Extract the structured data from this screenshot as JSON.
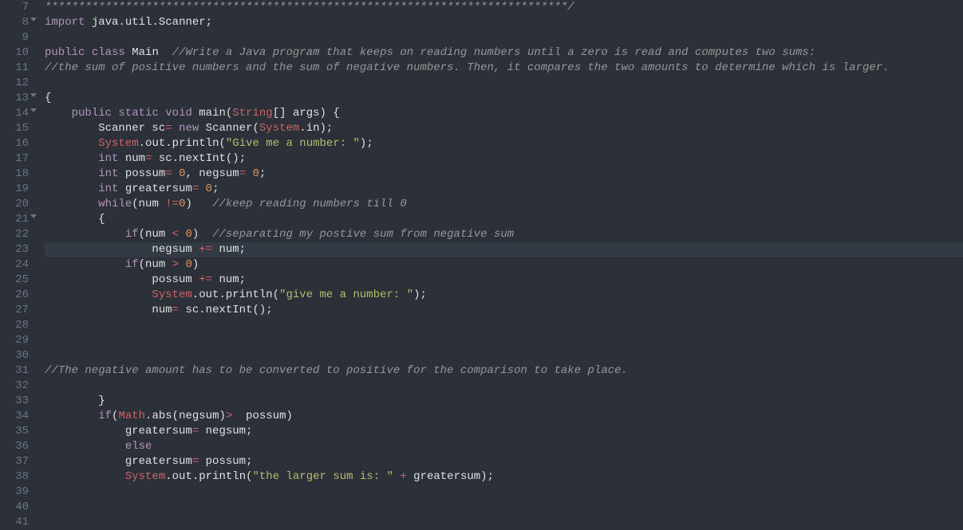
{
  "editor": {
    "startLine": 7,
    "activeLine": 23,
    "foldLines": [
      8,
      13,
      14,
      21
    ],
    "lines": [
      {
        "n": 7,
        "segs": [
          {
            "cls": "tok-comment",
            "t": "******************************************************************************/"
          }
        ]
      },
      {
        "n": 8,
        "segs": [
          {
            "cls": "tok-keyword2",
            "t": "import"
          },
          {
            "cls": "tok-ident",
            "t": " java"
          },
          {
            "cls": "tok-dot",
            "t": "."
          },
          {
            "cls": "tok-ident",
            "t": "util"
          },
          {
            "cls": "tok-dot",
            "t": "."
          },
          {
            "cls": "tok-ident",
            "t": "Scanner"
          },
          {
            "cls": "tok-punct",
            "t": ";"
          }
        ]
      },
      {
        "n": 9,
        "segs": []
      },
      {
        "n": 10,
        "segs": [
          {
            "cls": "tok-keyword2",
            "t": "public"
          },
          {
            "cls": "",
            "t": " "
          },
          {
            "cls": "tok-keyword2",
            "t": "class"
          },
          {
            "cls": "",
            "t": " "
          },
          {
            "cls": "tok-classname",
            "t": "Main"
          },
          {
            "cls": "",
            "t": "  "
          },
          {
            "cls": "tok-comment",
            "t": "//Write a Java program that keeps on reading numbers until a zero is read and computes two sums:"
          }
        ]
      },
      {
        "n": 11,
        "segs": [
          {
            "cls": "tok-comment",
            "t": "//the sum of positive numbers and the sum of negative numbers. Then, it compares the two amounts to determine which is larger."
          }
        ]
      },
      {
        "n": 12,
        "segs": []
      },
      {
        "n": 13,
        "segs": [
          {
            "cls": "tok-punct",
            "t": "{"
          }
        ]
      },
      {
        "n": 14,
        "segs": [
          {
            "cls": "",
            "t": "    "
          },
          {
            "cls": "tok-keyword2",
            "t": "public"
          },
          {
            "cls": "",
            "t": " "
          },
          {
            "cls": "tok-keyword2",
            "t": "static"
          },
          {
            "cls": "",
            "t": " "
          },
          {
            "cls": "tok-keyword2",
            "t": "void"
          },
          {
            "cls": "",
            "t": " "
          },
          {
            "cls": "tok-method",
            "t": "main"
          },
          {
            "cls": "tok-punct",
            "t": "("
          },
          {
            "cls": "tok-sysclass",
            "t": "String"
          },
          {
            "cls": "tok-punct",
            "t": "[]"
          },
          {
            "cls": "",
            "t": " "
          },
          {
            "cls": "tok-ident",
            "t": "args"
          },
          {
            "cls": "tok-punct",
            "t": ")"
          },
          {
            "cls": "",
            "t": " "
          },
          {
            "cls": "tok-punct",
            "t": "{"
          }
        ]
      },
      {
        "n": 15,
        "segs": [
          {
            "cls": "",
            "t": "        "
          },
          {
            "cls": "tok-ident",
            "t": "Scanner sc"
          },
          {
            "cls": "tok-keyword",
            "t": "="
          },
          {
            "cls": "",
            "t": " "
          },
          {
            "cls": "tok-keyword2",
            "t": "new"
          },
          {
            "cls": "",
            "t": " "
          },
          {
            "cls": "tok-ident",
            "t": "Scanner"
          },
          {
            "cls": "tok-punct",
            "t": "("
          },
          {
            "cls": "tok-sysclass",
            "t": "System"
          },
          {
            "cls": "tok-dot",
            "t": "."
          },
          {
            "cls": "tok-ident",
            "t": "in"
          },
          {
            "cls": "tok-punct",
            "t": ");"
          }
        ]
      },
      {
        "n": 16,
        "segs": [
          {
            "cls": "",
            "t": "        "
          },
          {
            "cls": "tok-sysclass",
            "t": "System"
          },
          {
            "cls": "tok-dot",
            "t": "."
          },
          {
            "cls": "tok-ident",
            "t": "out"
          },
          {
            "cls": "tok-dot",
            "t": "."
          },
          {
            "cls": "tok-method",
            "t": "println"
          },
          {
            "cls": "tok-punct",
            "t": "("
          },
          {
            "cls": "tok-string",
            "t": "\"Give me a number: \""
          },
          {
            "cls": "tok-punct",
            "t": ");"
          }
        ]
      },
      {
        "n": 17,
        "segs": [
          {
            "cls": "",
            "t": "        "
          },
          {
            "cls": "tok-keyword2",
            "t": "int"
          },
          {
            "cls": "",
            "t": " "
          },
          {
            "cls": "tok-ident",
            "t": "num"
          },
          {
            "cls": "tok-keyword",
            "t": "="
          },
          {
            "cls": "",
            "t": " "
          },
          {
            "cls": "tok-ident",
            "t": "sc"
          },
          {
            "cls": "tok-dot",
            "t": "."
          },
          {
            "cls": "tok-method",
            "t": "nextInt"
          },
          {
            "cls": "tok-punct",
            "t": "();"
          }
        ]
      },
      {
        "n": 18,
        "segs": [
          {
            "cls": "",
            "t": "        "
          },
          {
            "cls": "tok-keyword2",
            "t": "int"
          },
          {
            "cls": "",
            "t": " "
          },
          {
            "cls": "tok-ident",
            "t": "possum"
          },
          {
            "cls": "tok-keyword",
            "t": "="
          },
          {
            "cls": "",
            "t": " "
          },
          {
            "cls": "tok-const",
            "t": "0"
          },
          {
            "cls": "tok-punct",
            "t": ","
          },
          {
            "cls": "",
            "t": " "
          },
          {
            "cls": "tok-ident",
            "t": "negsum"
          },
          {
            "cls": "tok-keyword",
            "t": "="
          },
          {
            "cls": "",
            "t": " "
          },
          {
            "cls": "tok-const",
            "t": "0"
          },
          {
            "cls": "tok-punct",
            "t": ";"
          }
        ]
      },
      {
        "n": 19,
        "segs": [
          {
            "cls": "",
            "t": "        "
          },
          {
            "cls": "tok-keyword2",
            "t": "int"
          },
          {
            "cls": "",
            "t": " "
          },
          {
            "cls": "tok-ident",
            "t": "greatersum"
          },
          {
            "cls": "tok-keyword",
            "t": "="
          },
          {
            "cls": "",
            "t": " "
          },
          {
            "cls": "tok-const",
            "t": "0"
          },
          {
            "cls": "tok-punct",
            "t": ";"
          }
        ]
      },
      {
        "n": 20,
        "segs": [
          {
            "cls": "",
            "t": "        "
          },
          {
            "cls": "tok-keyword2",
            "t": "while"
          },
          {
            "cls": "tok-punct",
            "t": "("
          },
          {
            "cls": "tok-ident",
            "t": "num "
          },
          {
            "cls": "tok-keyword",
            "t": "!="
          },
          {
            "cls": "tok-const",
            "t": "0"
          },
          {
            "cls": "tok-punct",
            "t": ")"
          },
          {
            "cls": "",
            "t": "   "
          },
          {
            "cls": "tok-comment",
            "t": "//keep reading numbers till 0"
          }
        ]
      },
      {
        "n": 21,
        "segs": [
          {
            "cls": "",
            "t": "        "
          },
          {
            "cls": "tok-punct",
            "t": "{"
          }
        ]
      },
      {
        "n": 22,
        "segs": [
          {
            "cls": "",
            "t": "            "
          },
          {
            "cls": "tok-keyword2",
            "t": "if"
          },
          {
            "cls": "tok-punct",
            "t": "("
          },
          {
            "cls": "tok-ident",
            "t": "num "
          },
          {
            "cls": "tok-keyword",
            "t": "<"
          },
          {
            "cls": "",
            "t": " "
          },
          {
            "cls": "tok-const",
            "t": "0"
          },
          {
            "cls": "tok-punct",
            "t": ")"
          },
          {
            "cls": "",
            "t": "  "
          },
          {
            "cls": "tok-comment",
            "t": "//separating my postive sum from negative sum"
          }
        ]
      },
      {
        "n": 23,
        "segs": [
          {
            "cls": "",
            "t": "                "
          },
          {
            "cls": "tok-ident",
            "t": "negsum "
          },
          {
            "cls": "tok-keyword",
            "t": "+="
          },
          {
            "cls": "",
            "t": " "
          },
          {
            "cls": "tok-ident",
            "t": "num"
          },
          {
            "cls": "tok-punct",
            "t": ";"
          }
        ]
      },
      {
        "n": 24,
        "segs": [
          {
            "cls": "",
            "t": "            "
          },
          {
            "cls": "tok-keyword2",
            "t": "if"
          },
          {
            "cls": "tok-punct",
            "t": "("
          },
          {
            "cls": "tok-ident",
            "t": "num "
          },
          {
            "cls": "tok-keyword",
            "t": ">"
          },
          {
            "cls": "",
            "t": " "
          },
          {
            "cls": "tok-const",
            "t": "0"
          },
          {
            "cls": "tok-punct",
            "t": ")"
          }
        ]
      },
      {
        "n": 25,
        "segs": [
          {
            "cls": "",
            "t": "                "
          },
          {
            "cls": "tok-ident",
            "t": "possum "
          },
          {
            "cls": "tok-keyword",
            "t": "+="
          },
          {
            "cls": "",
            "t": " "
          },
          {
            "cls": "tok-ident",
            "t": "num"
          },
          {
            "cls": "tok-punct",
            "t": ";"
          }
        ]
      },
      {
        "n": 26,
        "segs": [
          {
            "cls": "",
            "t": "                "
          },
          {
            "cls": "tok-sysclass",
            "t": "System"
          },
          {
            "cls": "tok-dot",
            "t": "."
          },
          {
            "cls": "tok-ident",
            "t": "out"
          },
          {
            "cls": "tok-dot",
            "t": "."
          },
          {
            "cls": "tok-method",
            "t": "println"
          },
          {
            "cls": "tok-punct",
            "t": "("
          },
          {
            "cls": "tok-string",
            "t": "\"give me a number: \""
          },
          {
            "cls": "tok-punct",
            "t": ");"
          }
        ]
      },
      {
        "n": 27,
        "segs": [
          {
            "cls": "",
            "t": "                "
          },
          {
            "cls": "tok-ident",
            "t": "num"
          },
          {
            "cls": "tok-keyword",
            "t": "="
          },
          {
            "cls": "",
            "t": " "
          },
          {
            "cls": "tok-ident",
            "t": "sc"
          },
          {
            "cls": "tok-dot",
            "t": "."
          },
          {
            "cls": "tok-method",
            "t": "nextInt"
          },
          {
            "cls": "tok-punct",
            "t": "();"
          }
        ]
      },
      {
        "n": 28,
        "segs": [
          {
            "cls": "",
            "t": "                "
          }
        ]
      },
      {
        "n": 29,
        "segs": []
      },
      {
        "n": 30,
        "segs": []
      },
      {
        "n": 31,
        "segs": [
          {
            "cls": "tok-comment",
            "t": "//The negative amount has to be converted to positive for the comparison to take place."
          }
        ]
      },
      {
        "n": 32,
        "segs": []
      },
      {
        "n": 33,
        "segs": [
          {
            "cls": "",
            "t": "        "
          },
          {
            "cls": "tok-punct",
            "t": "}"
          }
        ]
      },
      {
        "n": 34,
        "segs": [
          {
            "cls": "",
            "t": "        "
          },
          {
            "cls": "tok-keyword2",
            "t": "if"
          },
          {
            "cls": "tok-punct",
            "t": "("
          },
          {
            "cls": "tok-sysclass",
            "t": "Math"
          },
          {
            "cls": "tok-dot",
            "t": "."
          },
          {
            "cls": "tok-method",
            "t": "abs"
          },
          {
            "cls": "tok-punct",
            "t": "("
          },
          {
            "cls": "tok-ident",
            "t": "negsum"
          },
          {
            "cls": "tok-punct",
            "t": ")"
          },
          {
            "cls": "tok-keyword",
            "t": ">"
          },
          {
            "cls": "",
            "t": "  "
          },
          {
            "cls": "tok-ident",
            "t": "possum"
          },
          {
            "cls": "tok-punct",
            "t": ")"
          }
        ]
      },
      {
        "n": 35,
        "segs": [
          {
            "cls": "",
            "t": "            "
          },
          {
            "cls": "tok-ident",
            "t": "greatersum"
          },
          {
            "cls": "tok-keyword",
            "t": "="
          },
          {
            "cls": "",
            "t": " "
          },
          {
            "cls": "tok-ident",
            "t": "negsum"
          },
          {
            "cls": "tok-punct",
            "t": ";"
          }
        ]
      },
      {
        "n": 36,
        "segs": [
          {
            "cls": "",
            "t": "            "
          },
          {
            "cls": "tok-keyword2",
            "t": "else"
          }
        ]
      },
      {
        "n": 37,
        "segs": [
          {
            "cls": "",
            "t": "            "
          },
          {
            "cls": "tok-ident",
            "t": "greatersum"
          },
          {
            "cls": "tok-keyword",
            "t": "="
          },
          {
            "cls": "",
            "t": " "
          },
          {
            "cls": "tok-ident",
            "t": "possum"
          },
          {
            "cls": "tok-punct",
            "t": ";"
          }
        ]
      },
      {
        "n": 38,
        "segs": [
          {
            "cls": "",
            "t": "            "
          },
          {
            "cls": "tok-sysclass",
            "t": "System"
          },
          {
            "cls": "tok-dot",
            "t": "."
          },
          {
            "cls": "tok-ident",
            "t": "out"
          },
          {
            "cls": "tok-dot",
            "t": "."
          },
          {
            "cls": "tok-method",
            "t": "println"
          },
          {
            "cls": "tok-punct",
            "t": "("
          },
          {
            "cls": "tok-string",
            "t": "\"the larger sum is: \""
          },
          {
            "cls": "",
            "t": " "
          },
          {
            "cls": "tok-keyword",
            "t": "+"
          },
          {
            "cls": "",
            "t": " "
          },
          {
            "cls": "tok-ident",
            "t": "greatersum"
          },
          {
            "cls": "tok-punct",
            "t": ");"
          }
        ]
      },
      {
        "n": 39,
        "segs": []
      },
      {
        "n": 40,
        "segs": []
      },
      {
        "n": 41,
        "segs": []
      }
    ]
  }
}
